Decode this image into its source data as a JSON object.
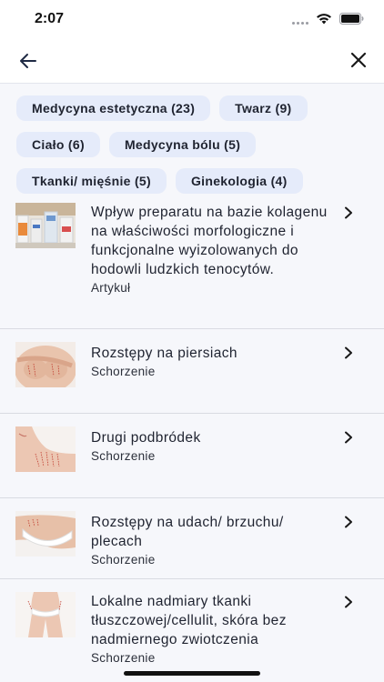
{
  "status": {
    "time": "2:07"
  },
  "icons": {
    "back": "arrow-left-icon",
    "close": "close-icon",
    "chevron": "chevron-right-icon"
  },
  "colors": {
    "chip_bg": "#e5ebfa",
    "background": "#f6f7fb"
  },
  "tags": [
    {
      "label": "Medycyna estetyczna (23)"
    },
    {
      "label": "Twarz (9)"
    },
    {
      "label": "Ciało (6)"
    },
    {
      "label": "Medycyna bólu (5)"
    },
    {
      "label": "Tkanki/ mięśnie (5)"
    },
    {
      "label": "Ginekologia (4)"
    }
  ],
  "results": [
    {
      "title": "Wpływ preparatu na bazie kolagenu na właściwości morfologiczne i funkcjonalne wyizolowanych do hodowli ludzkich tenocytów.",
      "type": "Artykuł"
    },
    {
      "title": "Rozstępy na piersiach",
      "type": "Schorzenie"
    },
    {
      "title": "Drugi podbródek",
      "type": "Schorzenie"
    },
    {
      "title": "Rozstępy na udach/ brzuchu/ plecach",
      "type": "Schorzenie"
    },
    {
      "title": "Lokalne nadmiary tkanki tłuszczowej/cellulit, skóra bez nadmiernego zwiotczenia",
      "type": "Schorzenie"
    }
  ]
}
